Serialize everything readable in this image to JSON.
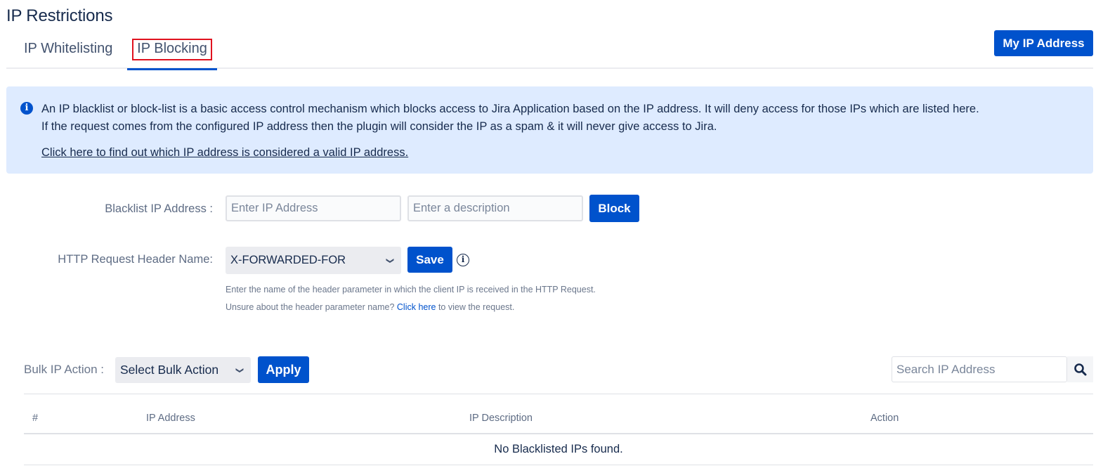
{
  "page": {
    "title": "IP Restrictions"
  },
  "tabs": [
    {
      "label": "IP Whitelisting",
      "active": false
    },
    {
      "label": "IP Blocking",
      "active": true
    }
  ],
  "header_actions": {
    "my_ip_label": "My IP Address"
  },
  "info_box": {
    "icon": "info-icon",
    "line1": "An IP blacklist or block-list is a basic access control mechanism which blocks access to Jira Application based on the IP address. It will deny access for those IPs which are listed here.",
    "line2": "If the request comes from the configured IP address then the plugin will consider the IP as a spam & it will never give access to Jira.",
    "link": "Click here to find out which IP address is considered a valid IP address."
  },
  "blacklist_form": {
    "label": "Blacklist IP Address :",
    "ip_placeholder": "Enter IP Address",
    "ip_value": "",
    "description_placeholder": "Enter a description",
    "description_value": "",
    "block_label": "Block"
  },
  "header_form": {
    "label": "HTTP Request Header Name:",
    "selected": "X-FORWARDED-FOR",
    "save_label": "Save",
    "help_icon": "info-circle-icon",
    "help_line1": "Enter the name of the header parameter in which the client IP is received in the HTTP Request.",
    "help_line2_prefix": "Unsure about the header parameter name? ",
    "help_line2_link": "Click here",
    "help_line2_suffix": " to view the request."
  },
  "bulk": {
    "label": "Bulk IP Action :",
    "selected": "Select Bulk Action",
    "apply_label": "Apply"
  },
  "search": {
    "placeholder": "Search IP Address",
    "value": "",
    "icon": "search-icon"
  },
  "table": {
    "columns": [
      "#",
      "IP Address",
      "IP Description",
      "Action"
    ],
    "rows": [],
    "empty_message": "No Blacklisted IPs found."
  },
  "colors": {
    "primary": "#0052cc",
    "info_bg": "#deebff",
    "highlight_border": "#e0121f"
  }
}
